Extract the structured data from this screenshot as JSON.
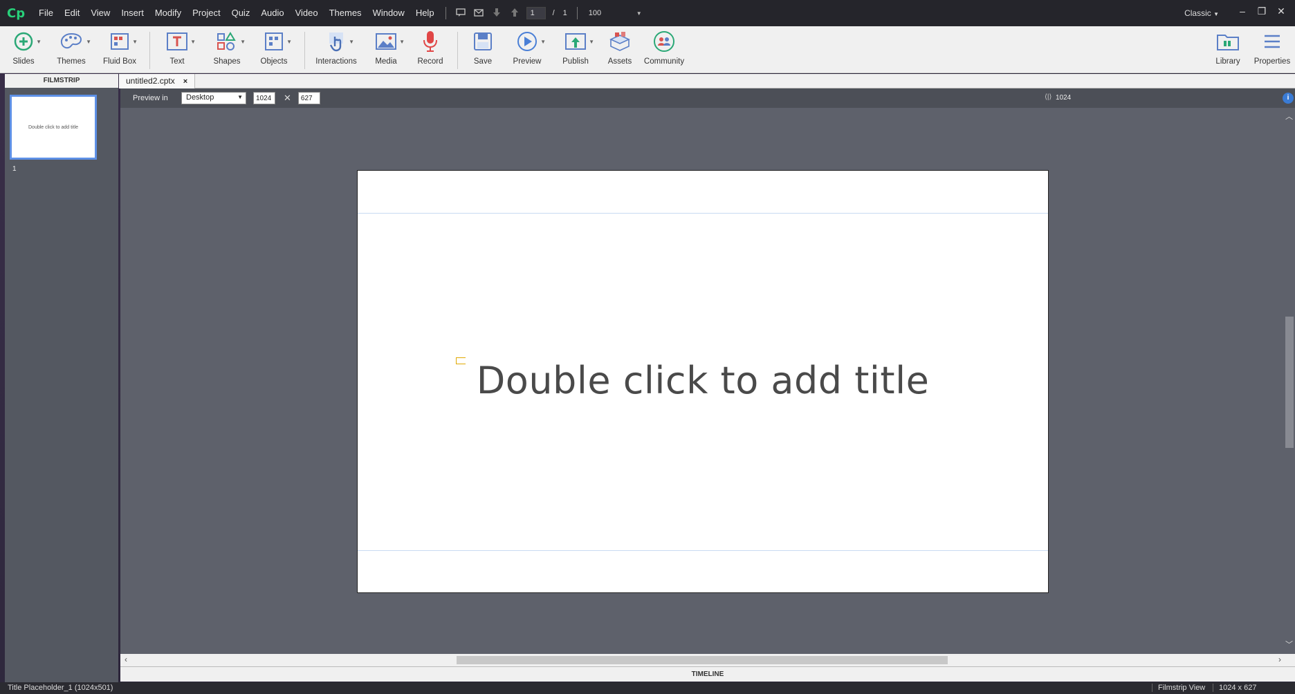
{
  "app": {
    "logo": "Cp"
  },
  "menubar": {
    "items": [
      "File",
      "Edit",
      "View",
      "Insert",
      "Modify",
      "Project",
      "Quiz",
      "Audio",
      "Video",
      "Themes",
      "Window",
      "Help"
    ],
    "slide_current": "1",
    "slide_sep": "/",
    "slide_total": "1",
    "zoom": "100",
    "workspace": "Classic"
  },
  "toolbar": {
    "slides": "Slides",
    "themes": "Themes",
    "fluidbox": "Fluid Box",
    "text": "Text",
    "shapes": "Shapes",
    "objects": "Objects",
    "interactions": "Interactions",
    "media": "Media",
    "record": "Record",
    "save": "Save",
    "preview": "Preview",
    "publish": "Publish",
    "assets": "Assets",
    "community": "Community",
    "library": "Library",
    "properties": "Properties"
  },
  "filmstrip": {
    "header": "FILMSTRIP",
    "thumb_text": "Double click to add title",
    "slide_number": "1"
  },
  "document": {
    "tab": "untitled2.cptx",
    "close": "×"
  },
  "previewbar": {
    "label": "Preview in",
    "device": "Desktop",
    "width": "1024",
    "height": "627",
    "ruler_value": "1024"
  },
  "slide": {
    "title_placeholder": "Double click to add title"
  },
  "timeline": {
    "label": "TIMELINE"
  },
  "status": {
    "selection": "Title Placeholder_1 (1024x501)",
    "view": "Filmstrip View",
    "size": "1024 x 627"
  },
  "colors": {
    "accent": "#5e90e6",
    "logo": "#28d07a",
    "stage": "#5e616b"
  }
}
